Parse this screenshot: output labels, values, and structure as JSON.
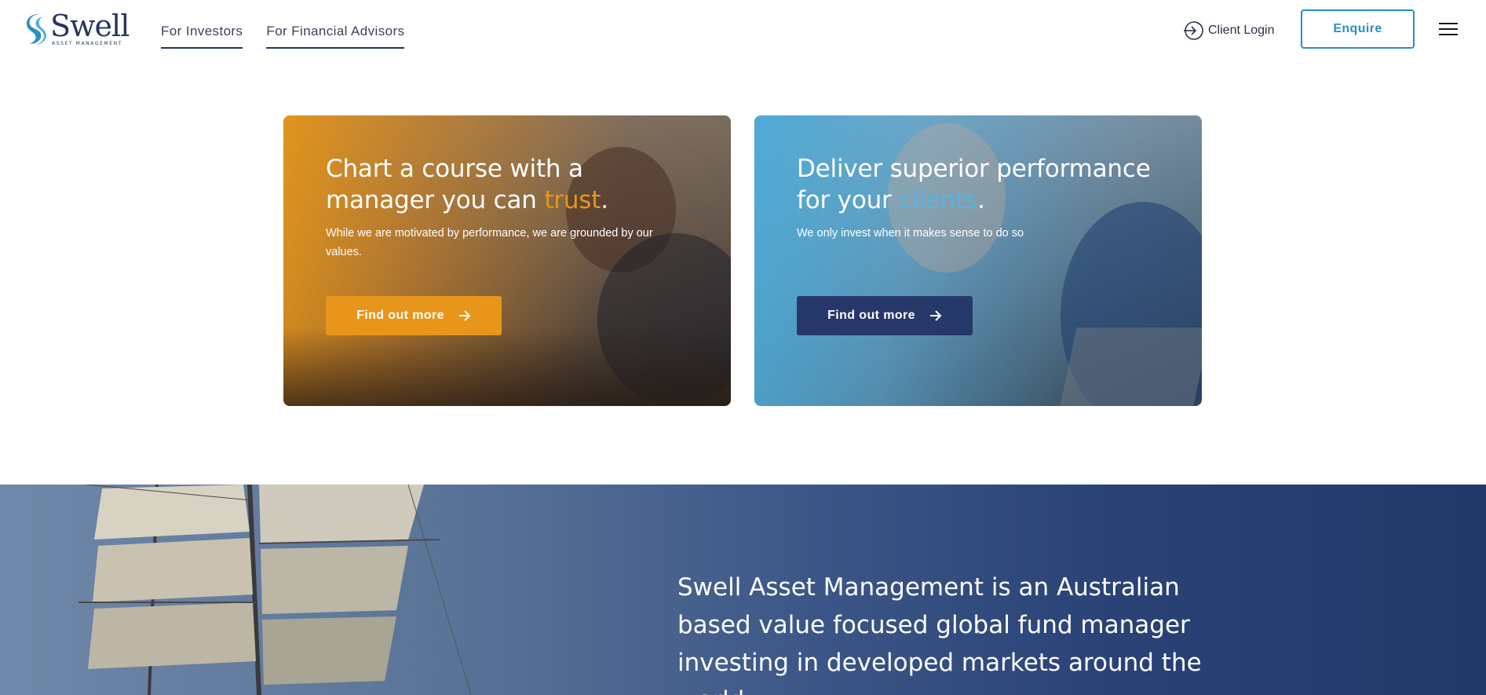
{
  "header": {
    "logo": {
      "word": "Swell",
      "sub": "ASSET MANAGEMENT"
    },
    "nav": [
      {
        "label": "For Investors"
      },
      {
        "label": "For Financial Advisors"
      }
    ],
    "client_login": "Client Login",
    "enquire": "Enquire",
    "icons": {
      "login": "login-arrow-icon",
      "menu": "hamburger-menu-icon"
    }
  },
  "cards": [
    {
      "title_line1": "Chart a course with a",
      "title_line2_prefix": "manager you can ",
      "title_accent": "trust",
      "title_suffix": ".",
      "description": "While we are motivated by performance, we are grounded by our values.",
      "button": "Find out more",
      "accent_color": "#e8951c"
    },
    {
      "title_line1": "Deliver superior performance",
      "title_line2_prefix": "for your ",
      "title_accent": "clients",
      "title_suffix": ".",
      "description": "We only invest when it makes sense to do so",
      "button": "Find out more",
      "accent_color": "#55b4e3"
    }
  ],
  "banner": {
    "text": "Swell Asset Management is an Australian based value focused global fund manager investing in developed markets around the world."
  },
  "colors": {
    "navy": "#26386a",
    "orange": "#e8951c",
    "blue": "#2a8fc4"
  }
}
